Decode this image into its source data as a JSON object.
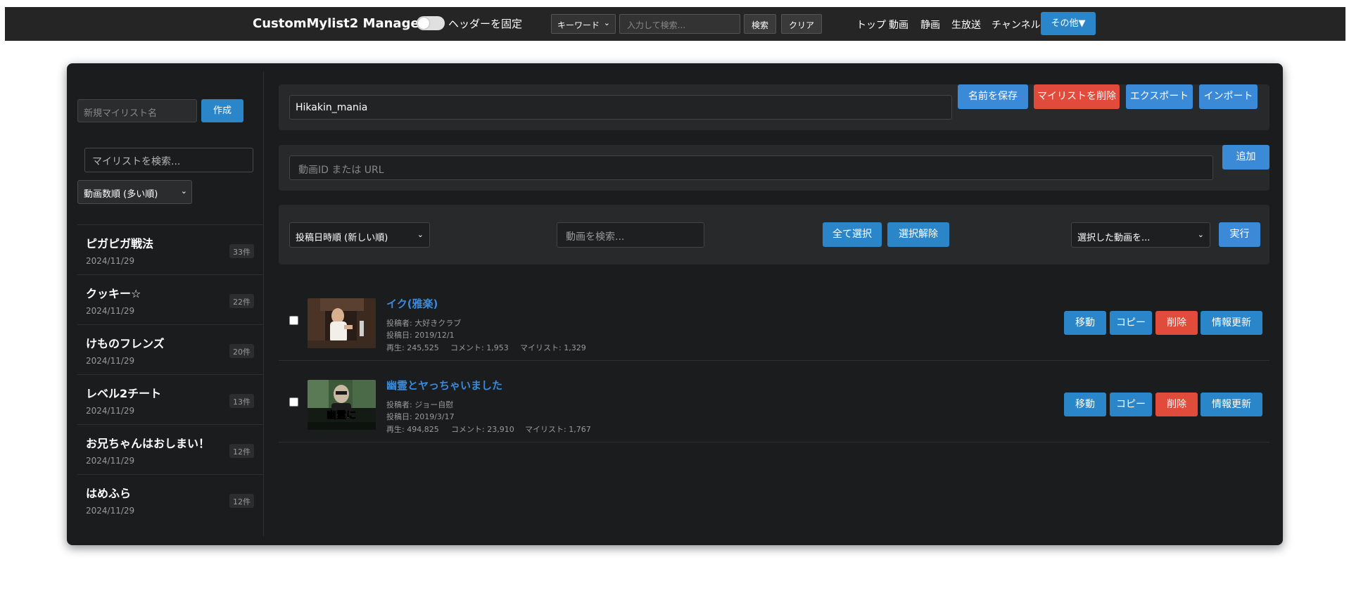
{
  "header": {
    "brand": "CustomMylist2 Manager",
    "fix_header_label": "ヘッダーを固定",
    "keyword_select": "キーワード",
    "search_placeholder": "入力して検索...",
    "search_button": "検索",
    "clear_button": "クリア",
    "nav": [
      "トップ",
      "動画",
      "静画",
      "生放送",
      "チャンネル"
    ],
    "more_button": "その他▼"
  },
  "sidebar": {
    "new_list_placeholder": "新規マイリスト名",
    "create_button": "作成",
    "list_search_placeholder": "マイリストを検索...",
    "sort_selected": "動画数順 (多い順)",
    "mylists": [
      {
        "name": "ピガピガ戦法",
        "date": "2024/11/29",
        "count": "33件"
      },
      {
        "name": "クッキー☆",
        "date": "2024/11/29",
        "count": "22件"
      },
      {
        "name": "けものフレンズ",
        "date": "2024/11/29",
        "count": "20件"
      },
      {
        "name": "レベル2チート",
        "date": "2024/11/29",
        "count": "13件"
      },
      {
        "name": "お兄ちゃんはおしまい！",
        "date": "2024/11/29",
        "count": "12件"
      },
      {
        "name": "はめふら",
        "date": "2024/11/29",
        "count": "12件"
      }
    ]
  },
  "editor": {
    "list_name_value": "Hikakin_mania",
    "save_name_button": "名前を保存",
    "delete_list_button": "マイリストを削除",
    "export_button": "エクスポート",
    "import_button": "インポート",
    "add_placeholder": "動画ID または URL",
    "add_button": "追加"
  },
  "toolbar": {
    "sort_selected": "投稿日時順 (新しい順)",
    "video_search_placeholder": "動画を検索...",
    "select_all_button": "全て選択",
    "deselect_button": "選択解除",
    "action_selected": "選択した動画を...",
    "execute_button": "実行"
  },
  "videos": [
    {
      "title": "イク(雅楽)",
      "uploader": "投稿者: 大好きクラブ",
      "posted": "投稿日: 2019/12/1",
      "views": "再生: 245,525",
      "comments": "コメント: 1,953",
      "mylists": "マイリスト: 1,329"
    },
    {
      "title": "幽霊とヤっちゃいました",
      "uploader": "投稿者: ジョー自慰",
      "posted": "投稿日: 2019/3/17",
      "views": "再生: 494,825",
      "comments": "コメント: 23,910",
      "mylists": "マイリスト: 1,767",
      "thumb_caption": "幽霊に"
    }
  ],
  "row_actions": {
    "move": "移動",
    "copy": "コピー",
    "delete": "削除",
    "refresh": "情報更新"
  },
  "colors": {
    "accent_blue": "#3b8ad8",
    "teal_button": "#2a86c9",
    "danger_red": "#e14b3b",
    "card_bg": "#1b1c1e",
    "panel_bg": "#28292b",
    "header_bg": "#252525"
  }
}
